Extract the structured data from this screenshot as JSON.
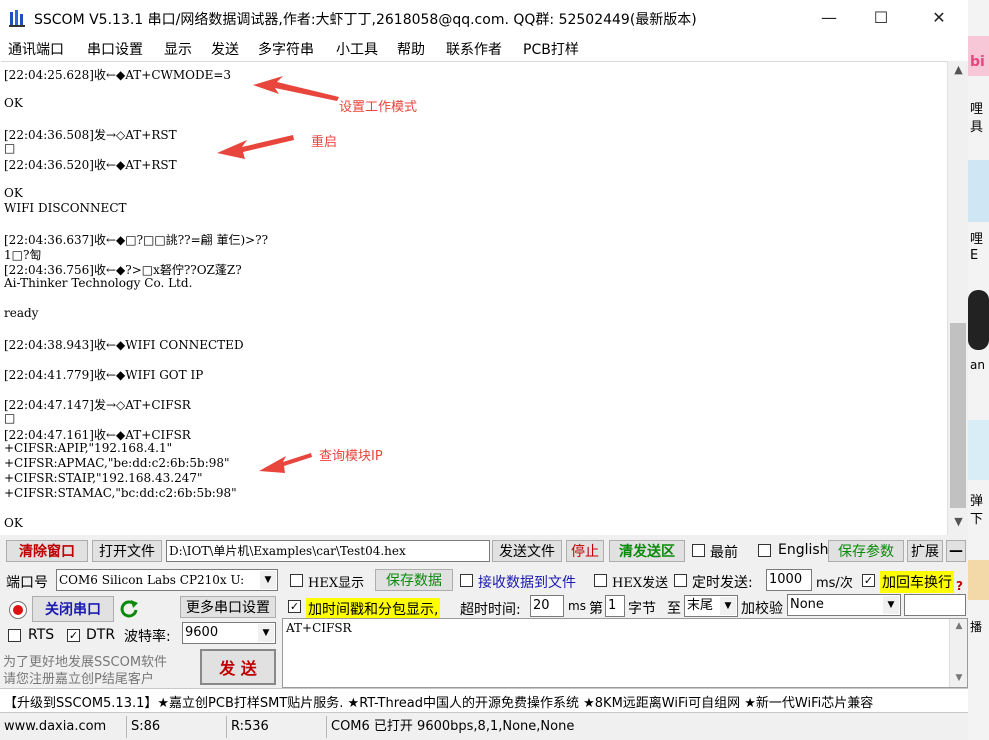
{
  "window": {
    "title": "SSCOM V5.13.1 串口/网络数据调试器,作者:大虾丁丁,2618058@qq.com. QQ群: 52502449(最新版本)",
    "controls": {
      "minimize": "—",
      "maximize": "☐",
      "close": "✕"
    }
  },
  "menu": [
    "通讯端口",
    "串口设置",
    "显示",
    "发送",
    "多字符串",
    "小工具",
    "帮助",
    "联系作者",
    "PCB打样"
  ],
  "receive_lines": [
    "[22:04:25.628]收←◆AT+CWMODE=3",
    "OK",
    "[22:04:36.508]发→◇AT+RST",
    "□",
    "[22:04:36.520]收←◆AT+RST",
    "OK",
    "WIFI DISCONNECT",
    "[22:04:36.637]收←◆□?□□誂??=翩  莗仨)>??",
    "1□?匋",
    "[22:04:36.756]收←◆?>□x砮佇??OZ蓬Z?",
    "Ai-Thinker Technology Co. Ltd.",
    "ready",
    "[22:04:38.943]收←◆WIFI CONNECTED",
    "[22:04:41.779]收←◆WIFI GOT IP",
    "[22:04:47.147]发→◇AT+CIFSR",
    "□",
    "[22:04:47.161]收←◆AT+CIFSR",
    "+CIFSR:APIP,\"192.168.4.1\"",
    "+CIFSR:APMAC,\"be:dd:c2:6b:5b:98\"",
    "+CIFSR:STAIP,\"192.168.43.247\"",
    "+CIFSR:STAMAC,\"bc:dd:c2:6b:5b:98\"",
    "OK"
  ],
  "annotations": {
    "mode": "设置工作模式",
    "restart": "重启",
    "query_ip": "查询模块IP"
  },
  "row1": {
    "clear_window": "清除窗口",
    "open_file": "打开文件",
    "file_path": "D:\\IOT\\单片机\\Examples\\car\\Test04.hex",
    "send_file": "发送文件",
    "stop": "停止",
    "clear_send": "清发送区",
    "last": "最前",
    "english": "English",
    "save_params": "保存参数",
    "expand": "扩展",
    "collapse": "—"
  },
  "row2": {
    "port_label": "端口号",
    "port_value": "COM6 Silicon Labs CP210x U:",
    "hex_display": "HEX显示",
    "save_data": "保存数据",
    "recv_to_file": "接收数据到文件",
    "hex_send": "HEX发送",
    "timed_send": "定时发送:",
    "interval": "1000",
    "interval_unit": "ms/次",
    "add_crlf": "加回车换行"
  },
  "row3": {
    "close_port": "关闭串口",
    "more_settings": "更多串口设置",
    "timestamp": "加时间戳和分包显示,",
    "timeout_label": "超时时间:",
    "timeout": "20",
    "timeout_unit": "ms",
    "byte_prefix": "第",
    "byte_index": "1",
    "byte_label": "字节",
    "to_label": "至",
    "end_value": "末尾",
    "checksum_label": "加校验",
    "checksum_value": "None",
    "help_q": "?"
  },
  "row4": {
    "rts": "RTS",
    "dtr": "DTR",
    "baud_label": "波特率:",
    "baud_value": "9600",
    "send_text": "AT+CIFSR"
  },
  "promo": {
    "line1": "为了更好地发展SSCOM软件",
    "line2": "请您注册嘉立创P结尾客户",
    "send": "发 送"
  },
  "marquee": "【升级到SSCOM5.13.1】★嘉立创PCB打样SMT贴片服务. ★RT-Thread中国人的开源免费操作系统 ★8KM远距离WiFi可自组网 ★新一代WiFi芯片兼容",
  "status": {
    "site": "www.daxia.com",
    "sent": "S:86",
    "received": "R:536",
    "port_status": "COM6 已打开  9600bps,8,1,None,None"
  },
  "colors": {
    "annotation": "#e8453c",
    "highlight": "#ffff00",
    "green_text": "#0a8a0a",
    "red_text": "#c00000"
  },
  "background_strip": [
    "bi",
    "哩",
    "具",
    "哩",
    "E",
    "an",
    "弹",
    "下",
    "播"
  ]
}
